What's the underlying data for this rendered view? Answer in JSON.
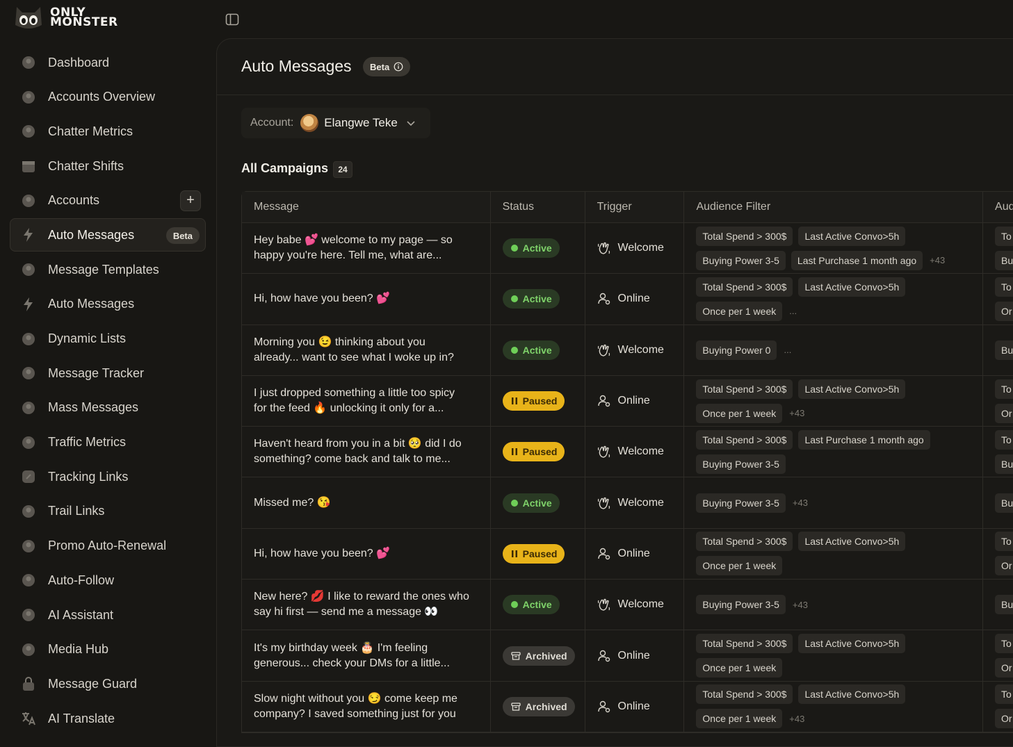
{
  "brand": {
    "line1": "ONLY",
    "line2": "MONSTER"
  },
  "sidebar": {
    "items": [
      {
        "label": "Dashboard",
        "icon": "dashboard-icon"
      },
      {
        "label": "Accounts Overview",
        "icon": "accounts-overview-icon"
      },
      {
        "label": "Chatter Metrics",
        "icon": "chatter-metrics-icon"
      },
      {
        "label": "Chatter Shifts",
        "icon": "calendar-icon"
      },
      {
        "label": "Accounts",
        "icon": "accounts-icon",
        "action": "+"
      },
      {
        "label": "Auto Messages",
        "icon": "lightning-icon",
        "badge": "Beta",
        "active": true
      },
      {
        "label": "Message Templates",
        "icon": "template-icon"
      },
      {
        "label": "Auto Messages",
        "icon": "lightning-icon"
      },
      {
        "label": "Dynamic Lists",
        "icon": "dynamic-lists-icon"
      },
      {
        "label": "Message Tracker",
        "icon": "message-tracker-icon"
      },
      {
        "label": "Mass Messages",
        "icon": "mass-messages-icon"
      },
      {
        "label": "Traffic Metrics",
        "icon": "traffic-icon"
      },
      {
        "label": "Tracking Links",
        "icon": "link-icon"
      },
      {
        "label": "Trail Links",
        "icon": "trail-icon"
      },
      {
        "label": "Promo Auto-Renewal",
        "icon": "promo-icon"
      },
      {
        "label": "Auto-Follow",
        "icon": "follow-icon"
      },
      {
        "label": "AI Assistant",
        "icon": "ai-icon"
      },
      {
        "label": "Media Hub",
        "icon": "media-icon"
      },
      {
        "label": "Message Guard",
        "icon": "lock-icon"
      },
      {
        "label": "AI Translate",
        "icon": "translate-icon"
      }
    ]
  },
  "header": {
    "title": "Auto Messages",
    "badge": "Beta"
  },
  "account": {
    "label": "Account:",
    "name": "Elangwe Teke"
  },
  "campaigns": {
    "title": "All Campaigns",
    "count": "24"
  },
  "table": {
    "columns": [
      "Message",
      "Status",
      "Trigger",
      "Audience Filter",
      "Aud"
    ],
    "rows": [
      {
        "message": "Hey babe 💕 welcome to my page — so happy you're here. Tell me, what are...",
        "status": "Active",
        "trigger": "Welcome",
        "tags": [
          "Total Spend > 300$",
          "Last Active Convo>5h",
          "Buying Power 3-5",
          "Last Purchase 1 month ago"
        ],
        "more": "+43",
        "aud2": [
          "To",
          "Bu"
        ]
      },
      {
        "message": "Hi, how have you been? 💕",
        "status": "Active",
        "trigger": "Online",
        "tags": [
          "Total Spend > 300$",
          "Last Active Convo>5h",
          "Once per 1 week"
        ],
        "more": "...",
        "aud2": [
          "To",
          "Or"
        ]
      },
      {
        "message": "Morning you 😉 thinking about you already... want to see what I woke up in?",
        "status": "Active",
        "trigger": "Welcome",
        "tags": [
          "Buying Power 0"
        ],
        "more": "...",
        "aud2": [
          "Bu"
        ]
      },
      {
        "message": "I just dropped something a little too spicy for the feed 🔥 unlocking it only for a...",
        "status": "Paused",
        "trigger": "Online",
        "tags": [
          "Total Spend > 300$",
          "Last Active Convo>5h",
          "Once per 1 week"
        ],
        "more": "+43",
        "aud2": [
          "To",
          "Or"
        ]
      },
      {
        "message": "Haven't heard from you in a bit 🥺 did I do something? come back and talk to me...",
        "status": "Paused",
        "trigger": "Welcome",
        "tags": [
          "Total Spend > 300$",
          "Last Purchase 1 month ago",
          "Buying Power 3-5"
        ],
        "more": "",
        "aud2": [
          "To",
          "Bu"
        ]
      },
      {
        "message": "Missed me? 😘",
        "status": "Active",
        "trigger": "Welcome",
        "tags": [
          "Buying Power 3-5"
        ],
        "more": "+43",
        "aud2": [
          "Bu"
        ]
      },
      {
        "message": "Hi, how have you been? 💕",
        "status": "Paused",
        "trigger": "Online",
        "tags": [
          "Total Spend > 300$",
          "Last Active Convo>5h",
          "Once per 1 week"
        ],
        "more": "",
        "aud2": [
          "To",
          "Or"
        ]
      },
      {
        "message": "New here? 💋 I like to reward the ones who say hi first — send me a message 👀",
        "status": "Active",
        "trigger": "Welcome",
        "tags": [
          "Buying Power 3-5"
        ],
        "more": "+43",
        "aud2": [
          "Bu"
        ]
      },
      {
        "message": "It's my birthday week 🎂 I'm feeling generous... check your DMs for a little...",
        "status": "Archived",
        "trigger": "Online",
        "tags": [
          "Total Spend > 300$",
          "Last Active Convo>5h",
          "Once per 1 week"
        ],
        "more": "",
        "aud2": [
          "To",
          "Or"
        ]
      },
      {
        "message": "Slow night without you 😏 come keep me company? I saved something just for you",
        "status": "Archived",
        "trigger": "Online",
        "tags": [
          "Total Spend > 300$",
          "Last Active Convo>5h",
          "Once per 1 week"
        ],
        "more": "+43",
        "aud2": [
          "To",
          "Or"
        ]
      }
    ]
  },
  "colors": {
    "accent_active": "#7fd36a",
    "paused": "#e8b319",
    "archived": "#3b3935"
  }
}
